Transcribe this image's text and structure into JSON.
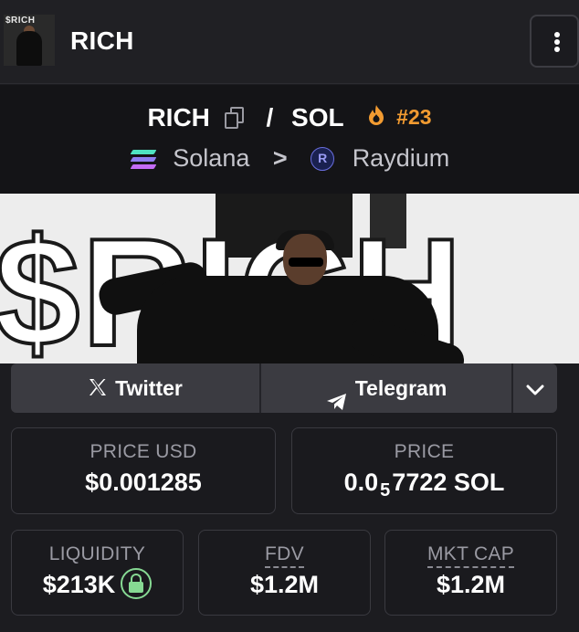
{
  "header": {
    "title": "RICH",
    "avatar_text": "$RICH"
  },
  "pair": {
    "base": "RICH",
    "separator": "/",
    "quote": "SOL",
    "rank": "#23",
    "chain": "Solana",
    "chain_separator": ">",
    "dex": "Raydium",
    "dex_icon_letter": "R"
  },
  "banner": {
    "text": "$RICH"
  },
  "social": {
    "twitter_label": "Twitter",
    "telegram_label": "Telegram"
  },
  "stats": {
    "price_usd": {
      "label": "PRICE USD",
      "value": "$0.001285"
    },
    "price": {
      "label": "PRICE",
      "prefix": "0.0",
      "sub": "5",
      "suffix": "7722 SOL"
    },
    "liquidity": {
      "label": "LIQUIDITY",
      "value": "$213K"
    },
    "fdv": {
      "label": "FDV",
      "value": "$1.2M"
    },
    "mkt_cap": {
      "label": "MKT CAP",
      "value": "$1.2M"
    }
  },
  "colors": {
    "accent_orange": "#f29b31",
    "lock_green": "#86d993",
    "background": "#1c1c20"
  }
}
